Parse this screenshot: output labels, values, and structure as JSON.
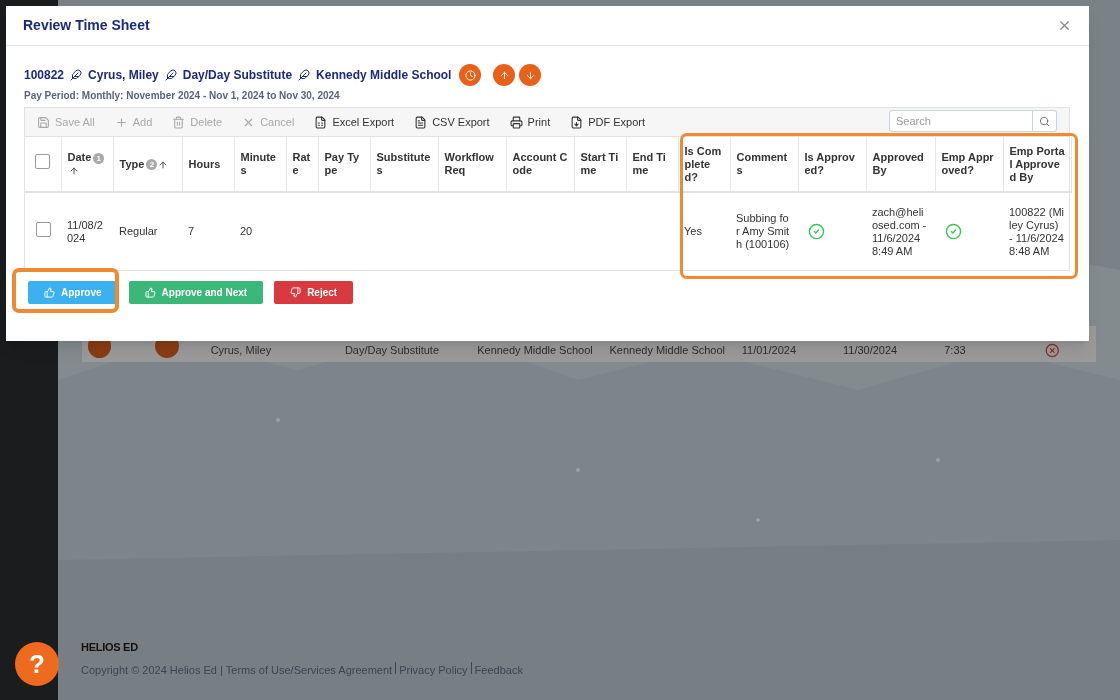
{
  "dialog": {
    "title": "Review Time Sheet",
    "employee": {
      "id": "100822",
      "name": "Cyrus, Miley",
      "position": "Day/Day Substitute",
      "location": "Kennedy Middle School"
    },
    "pay_period": "Pay Period: Monthly: November 2024 - Nov 1, 2024 to Nov 30, 2024",
    "toolbar": [
      {
        "label": "Save All",
        "disabled": true
      },
      {
        "label": "Add",
        "disabled": true
      },
      {
        "label": "Delete",
        "disabled": true
      },
      {
        "label": "Cancel",
        "disabled": true
      },
      {
        "label": "Excel Export",
        "disabled": false
      },
      {
        "label": "CSV Export",
        "disabled": false
      },
      {
        "label": "Print",
        "disabled": false
      },
      {
        "label": "PDF Export",
        "disabled": false
      }
    ],
    "search": {
      "placeholder": "Search"
    },
    "header_checkbox": {
      "checked": false
    },
    "columns": [
      {
        "label": "Date",
        "sort_order": "1"
      },
      {
        "label": "Type",
        "sort_order": "2"
      },
      {
        "label": "Hours"
      },
      {
        "label": "Minutes"
      },
      {
        "label": "Rate"
      },
      {
        "label": "Pay Type"
      },
      {
        "label": "Substitutes"
      },
      {
        "label": "Workflow Req"
      },
      {
        "label": "Account Code"
      },
      {
        "label": "Start Time"
      },
      {
        "label": "End Time"
      },
      {
        "label": "Is Completed?"
      },
      {
        "label": "Comments"
      },
      {
        "label": "Is Approved?"
      },
      {
        "label": "Approved By"
      },
      {
        "label": "Emp Approved?"
      },
      {
        "label": "Emp Portal Approved By"
      }
    ],
    "rows": [
      {
        "checked": false,
        "cells": [
          {
            "kind": "text",
            "text": "11/08/2024"
          },
          {
            "kind": "text",
            "text": "Regular"
          },
          {
            "kind": "text",
            "text": "7"
          },
          {
            "kind": "text",
            "text": "20"
          },
          {
            "kind": "blank"
          },
          {
            "kind": "blank"
          },
          {
            "kind": "blank"
          },
          {
            "kind": "blank"
          },
          {
            "kind": "blank"
          },
          {
            "kind": "blank"
          },
          {
            "kind": "blank"
          },
          {
            "kind": "text",
            "text": "Yes"
          },
          {
            "kind": "text",
            "text": "Subbing for Amy Smith (100106)"
          },
          {
            "kind": "check",
            "checked": true
          },
          {
            "kind": "text",
            "text": "zach@heliosed.com - 11/6/2024 8:49 AM"
          },
          {
            "kind": "check",
            "checked": true
          },
          {
            "kind": "text",
            "text": "100822 (Miley Cyrus) - 11/6/2024 8:48 AM"
          }
        ]
      }
    ],
    "actions": [
      {
        "label": "Approve",
        "color": "#3bb1f0"
      },
      {
        "label": "Approve and Next",
        "color": "#3bb77a"
      },
      {
        "label": "Reject",
        "color": "#d93a3f"
      }
    ]
  },
  "background_row": [
    "Cyrus, Miley",
    "Day/Day Substitute",
    "Kennedy Middle School",
    "Kennedy Middle School",
    "11/01/2024",
    "11/30/2024",
    "7:33"
  ],
  "footer": {
    "brand": "HELIOS ED",
    "copyright": "Copyright © 2024 Helios Ed |",
    "links": [
      "Terms of Use/Services Agreement",
      "Privacy Policy",
      "Feedback"
    ]
  },
  "help_button": "?"
}
